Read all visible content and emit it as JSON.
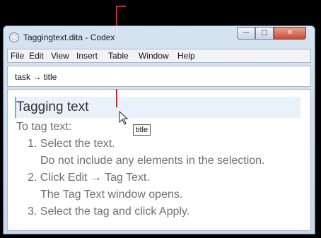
{
  "window": {
    "title": "Taggingtext.dita - Codex",
    "minimize_label": "—",
    "maximize_label": "□",
    "close_label": "✕"
  },
  "menubar": {
    "items": [
      "File",
      "Edit",
      "View",
      "Insert",
      "Table",
      "Window",
      "Help"
    ]
  },
  "breadcrumb": "task → title",
  "document": {
    "title": "Tagging text",
    "lines": [
      "To tag text:",
      "1. Select the text.",
      "Do not include any elements in the selection.",
      "2. Click Edit → Tag Text.",
      "The Tag Text window opens.",
      "3. Select the tag and click Apply."
    ]
  },
  "tooltip": "title",
  "colors": {
    "callout": "#e2231a",
    "close_button": "#c74b35",
    "title_highlight": "#e9f1fa"
  },
  "icons": {
    "app": "codex-app-icon",
    "pointer": "mouse-pointer-icon"
  }
}
